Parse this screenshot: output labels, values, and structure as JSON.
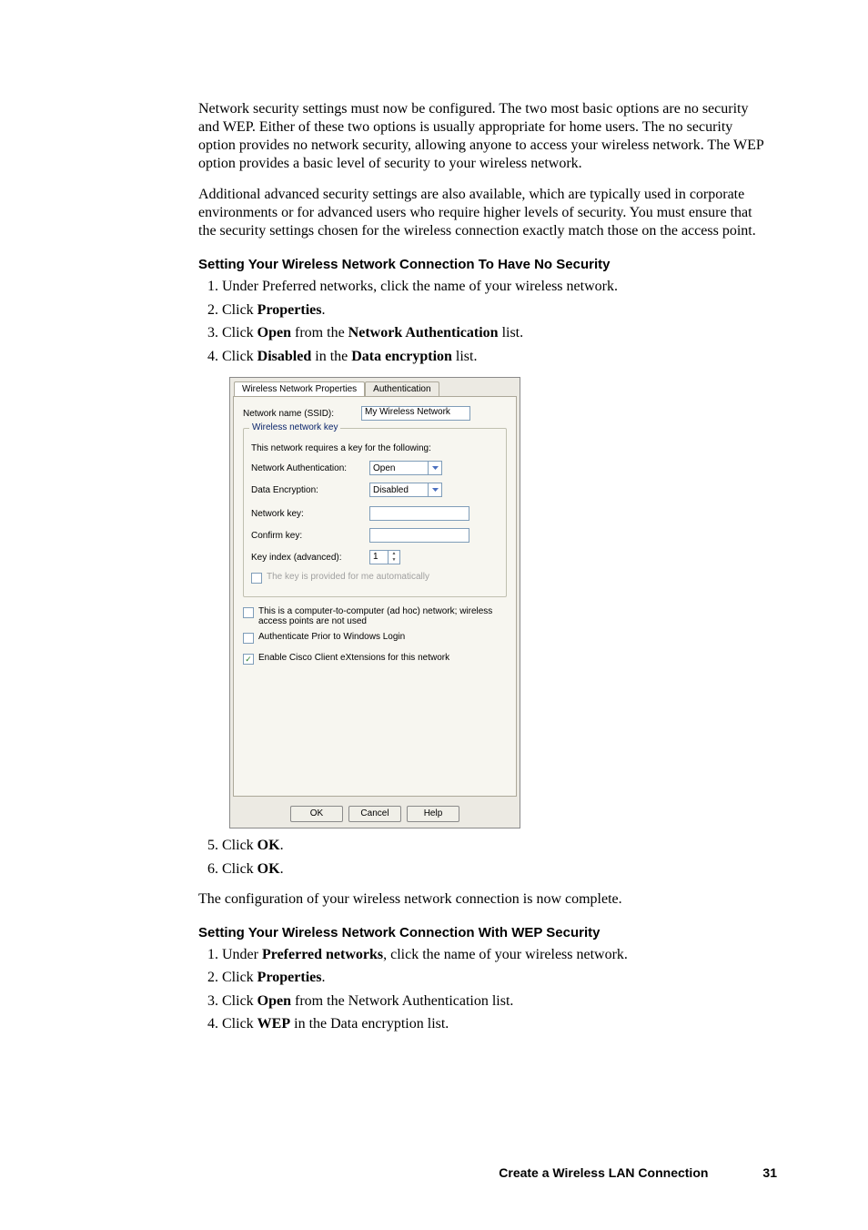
{
  "body": {
    "para1": "Network security settings must now be configured. The two most basic options are no security and WEP. Either of these two options is usually appropriate for home users. The no security option provides no network security, allowing anyone to access your wireless network. The WEP option provides a basic level of security to your wireless network.",
    "para2": "Additional advanced security settings are also available, which are typically used in corporate environments or for advanced users who require higher levels of security. You must ensure that the security settings chosen for the wireless connection exactly match those on the access point."
  },
  "sectionA": {
    "heading": "Setting Your Wireless Network Connection To Have No Security",
    "steps": {
      "s1": "Under Preferred networks, click the name of your wireless network.",
      "s2_a": "Click ",
      "s2_b": "Properties",
      "s2_c": ".",
      "s3_a": "Click ",
      "s3_b": "Open",
      "s3_c": " from the ",
      "s3_d": "Network Authentication",
      "s3_e": " list.",
      "s4_a": "Click ",
      "s4_b": "Disabled",
      "s4_c": " in the ",
      "s4_d": "Data encryption",
      "s4_e": " list.",
      "s5_a": "Click ",
      "s5_b": "OK",
      "s5_c": ".",
      "s6_a": "Click ",
      "s6_b": "OK",
      "s6_c": "."
    },
    "closing": "The configuration of your wireless network connection is now complete."
  },
  "dialog": {
    "tabs": {
      "tab1": "Wireless Network Properties",
      "tab2": "Authentication"
    },
    "ssid_label": "Network name (SSID):",
    "ssid_value": "My Wireless Network",
    "group_label": "Wireless network key",
    "req_text": "This network requires a key for the following:",
    "auth_label": "Network Authentication:",
    "auth_value": "Open",
    "enc_label": "Data Encryption:",
    "enc_value": "Disabled",
    "netkey_label": "Network key:",
    "confkey_label": "Confirm key:",
    "idx_label": "Key index (advanced):",
    "idx_value": "1",
    "cb_auto": "The key is provided for me automatically",
    "cb_adhoc": "This is a computer-to-computer (ad hoc) network; wireless access points are not used",
    "cb_prior": "Authenticate Prior to Windows Login",
    "cb_cisco": "Enable Cisco Client eXtensions for this network",
    "btn_ok": "OK",
    "btn_cancel": "Cancel",
    "btn_help": "Help"
  },
  "sectionB": {
    "heading": "Setting Your Wireless Network Connection With WEP Security",
    "steps": {
      "s1_a": "Under ",
      "s1_b": "Preferred networks",
      "s1_c": ", click the name of your wireless network.",
      "s2_a": "Click ",
      "s2_b": "Properties",
      "s2_c": ".",
      "s3_a": "Click ",
      "s3_b": "Open",
      "s3_c": " from the Network Authentication list.",
      "s4_a": "Click ",
      "s4_b": "WEP",
      "s4_c": " in the Data encryption list."
    }
  },
  "footer": {
    "title": "Create a Wireless LAN Connection",
    "page": "31"
  }
}
